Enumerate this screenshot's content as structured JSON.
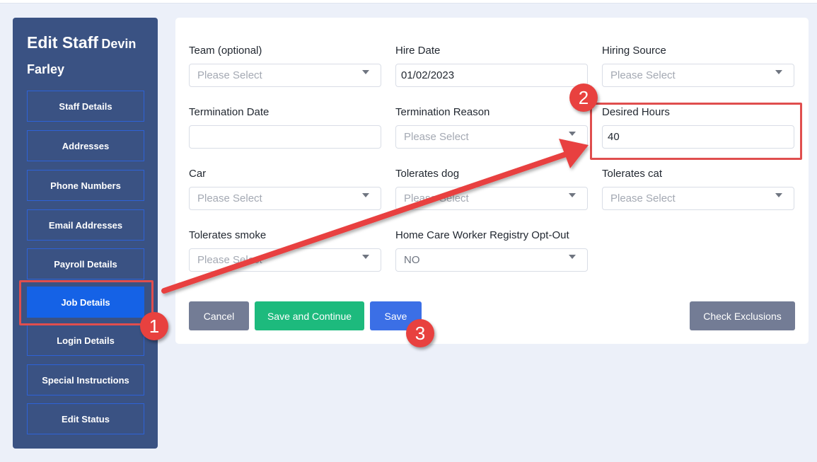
{
  "sidebar": {
    "title": "Edit Staff",
    "staff_name": "Devin Farley",
    "items": [
      {
        "label": "Staff Details"
      },
      {
        "label": "Addresses"
      },
      {
        "label": "Phone Numbers"
      },
      {
        "label": "Email Addresses"
      },
      {
        "label": "Payroll Details"
      },
      {
        "label": "Job Details",
        "active": true
      },
      {
        "label": "Login Details"
      },
      {
        "label": "Special Instructions"
      },
      {
        "label": "Edit Status"
      }
    ]
  },
  "form": {
    "team": {
      "label": "Team (optional)",
      "placeholder": "Please Select"
    },
    "hire_date": {
      "label": "Hire Date",
      "value": "01/02/2023"
    },
    "hiring_source": {
      "label": "Hiring Source",
      "placeholder": "Please Select"
    },
    "termination_date": {
      "label": "Termination Date",
      "value": ""
    },
    "termination_reason": {
      "label": "Termination Reason",
      "placeholder": "Please Select"
    },
    "desired_hours": {
      "label": "Desired Hours",
      "value": "40"
    },
    "car": {
      "label": "Car",
      "placeholder": "Please Select"
    },
    "tolerates_dog": {
      "label": "Tolerates dog",
      "placeholder": "Please Select"
    },
    "tolerates_cat": {
      "label": "Tolerates cat",
      "placeholder": "Please Select"
    },
    "tolerates_smoke": {
      "label": "Tolerates smoke",
      "placeholder": "Please Select"
    },
    "registry_opt_out": {
      "label": "Home Care Worker Registry Opt-Out",
      "value": "NO"
    }
  },
  "buttons": {
    "cancel": "Cancel",
    "save_continue": "Save and Continue",
    "save": "Save",
    "check_exclusions": "Check Exclusions"
  },
  "annotations": {
    "badge_1": "1",
    "badge_2": "2",
    "badge_3": "3",
    "color": "#e8413f"
  },
  "colors": {
    "sidebar_bg": "#3a5283",
    "active_nav": "#1562e6",
    "save_continue": "#1dba7d",
    "save": "#3b6fe6",
    "neutral_button": "#737c95"
  }
}
